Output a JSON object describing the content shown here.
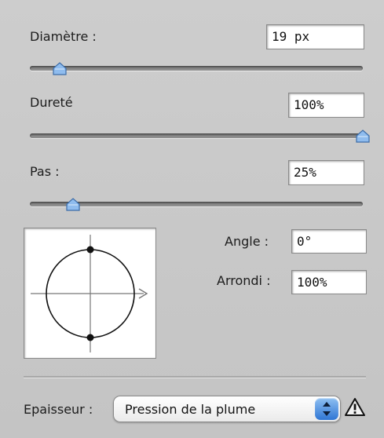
{
  "brush": {
    "diameter": {
      "label": "Diamètre :",
      "value": "19 px",
      "level": 0.09
    },
    "hardness": {
      "label": "Dureté",
      "value": "100%",
      "level": 1.0
    },
    "spacing": {
      "label": "Pas :",
      "value": "25%",
      "level": 0.13
    },
    "angle": {
      "label": "Angle :",
      "value": "0°"
    },
    "roundness": {
      "label": "Arrondi :",
      "value": "100%"
    }
  },
  "preview": {
    "arrow_icon": "arrow-right-icon"
  },
  "control": {
    "label": "Epaisseur :",
    "selected": "Pression de la plume",
    "select_icon": "up-down-arrows-icon",
    "warning_icon": "warning-triangle-icon"
  },
  "colors": {
    "panel_bg": "#c8c8c8",
    "thumb_blue": "#7fb0e8",
    "select_blue": "#2f76d4"
  }
}
